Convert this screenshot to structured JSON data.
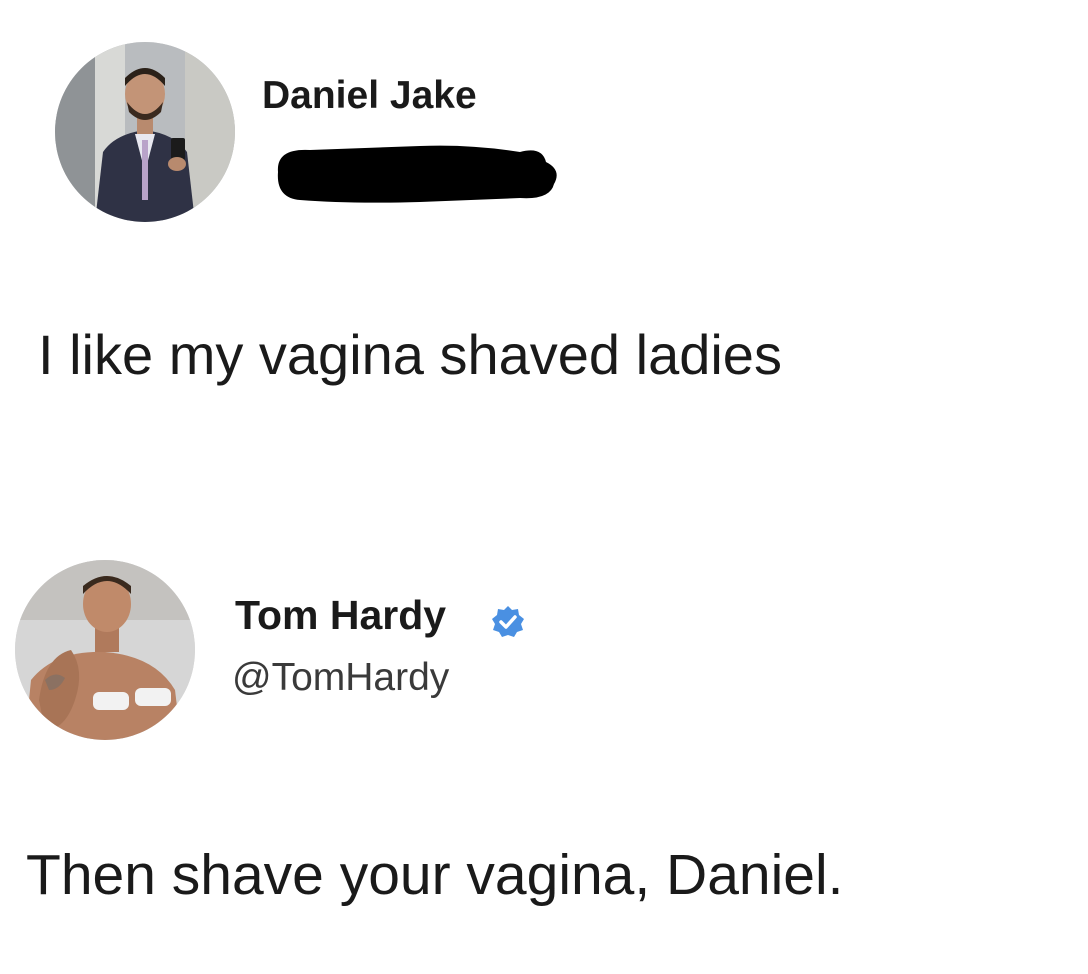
{
  "posts": [
    {
      "author": {
        "display_name": "Daniel Jake",
        "avatar_icon": "avatar-photo-man-in-suit",
        "handle_redacted": true
      },
      "text": "I like my vagina shaved ladies"
    },
    {
      "author": {
        "display_name": "Tom Hardy",
        "handle": "@TomHardy",
        "avatar_icon": "avatar-photo-boxer",
        "verified": true,
        "verified_icon": "verified-badge-icon"
      },
      "text": "Then shave your vagina, Daniel."
    }
  ],
  "colors": {
    "background": "#ffffff",
    "text": "#1a1a1a",
    "handle": "#3a3a3a",
    "verified": "#4a90e2",
    "redaction": "#000000"
  }
}
